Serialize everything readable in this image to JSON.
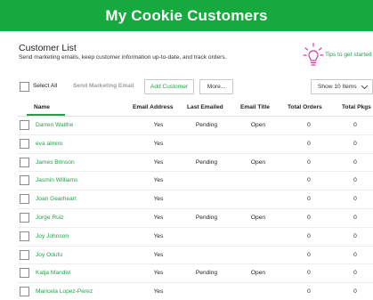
{
  "banner": {
    "title": "My Cookie Customers"
  },
  "header": {
    "title": "Customer List",
    "subtitle": "Send marketing emails, keep customer information up-to-date, and track orders.",
    "tips_label": "Tips to get started"
  },
  "toolbar": {
    "select_all_label": "Select All",
    "send_marketing_label": "Send Marketing Email",
    "add_customer_label": "Add Customer",
    "more_label": "More...",
    "show_items_value": "Show 10 Items"
  },
  "table": {
    "columns": {
      "name": "Name",
      "email_address": "Email Address",
      "last_emailed": "Last Emailed",
      "email_title": "Email Title",
      "total_orders": "Total Orders",
      "total_pkgs": "Total Pkgs"
    },
    "rows": [
      {
        "name": "Darren Waithe",
        "email": "Yes",
        "last": "Pending",
        "title": "Open",
        "orders": "0",
        "pkgs": "0"
      },
      {
        "name": "eva almiro",
        "email": "Yes",
        "last": "",
        "title": "",
        "orders": "0",
        "pkgs": "0"
      },
      {
        "name": "James Brinson",
        "email": "Yes",
        "last": "Pending",
        "title": "Open",
        "orders": "0",
        "pkgs": "0"
      },
      {
        "name": "Jasmin Williams",
        "email": "Yes",
        "last": "",
        "title": "",
        "orders": "0",
        "pkgs": "0"
      },
      {
        "name": "Joan Gearheart",
        "email": "Yes",
        "last": "",
        "title": "",
        "orders": "0",
        "pkgs": "0"
      },
      {
        "name": "Jorge Ruiz",
        "email": "Yes",
        "last": "Pending",
        "title": "Open",
        "orders": "0",
        "pkgs": "0"
      },
      {
        "name": "Joy Johnson",
        "email": "Yes",
        "last": "",
        "title": "",
        "orders": "0",
        "pkgs": "0"
      },
      {
        "name": "Joy Odufu",
        "email": "Yes",
        "last": "",
        "title": "",
        "orders": "0",
        "pkgs": "0"
      },
      {
        "name": "Katja Mandivi",
        "email": "Yes",
        "last": "Pending",
        "title": "Open",
        "orders": "0",
        "pkgs": "0"
      },
      {
        "name": "Maricela Lopez-Perez",
        "email": "Yes",
        "last": "",
        "title": "",
        "orders": "0",
        "pkgs": "0"
      }
    ]
  },
  "colors": {
    "brand_green": "#16a93d",
    "link_green": "#1fa24a",
    "tips_icon": "#d63aa8"
  },
  "icons": {
    "tips": "lightbulb-icon",
    "dropdown": "chevron-down-icon"
  }
}
